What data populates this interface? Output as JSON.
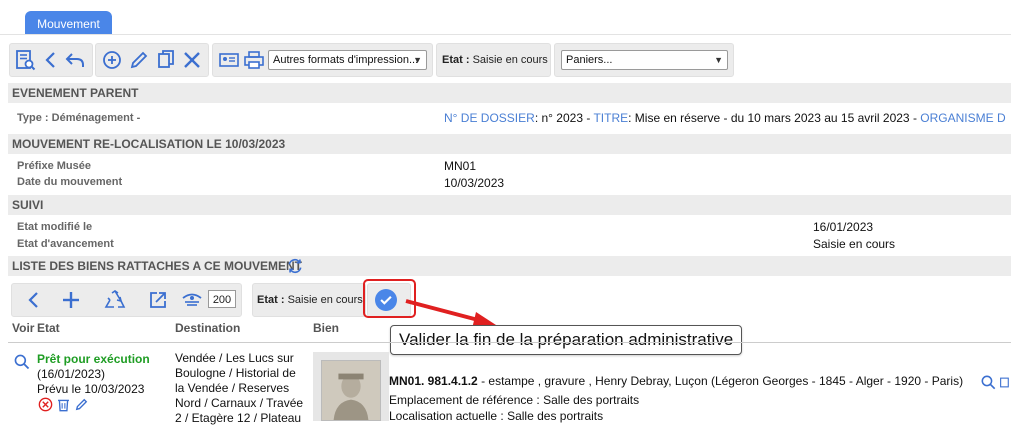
{
  "tab": {
    "label": "Mouvement"
  },
  "toolbar": {
    "print_formats": "Autres formats d'impression...",
    "etat_label": "Etat :",
    "etat_value": "Saisie en cours",
    "paniers": "Paniers..."
  },
  "parent": {
    "header": "EVENEMENT PARENT",
    "type_label": "Type : Déménagement -",
    "dossier_label": "N° DE DOSSIER",
    "dossier_value": ": n° 2023 -",
    "titre_label": "TITRE",
    "titre_value": ": Mise en réserve - du 10 mars 2023 au 15 avril 2023 -",
    "organisme_label": "ORGANISME D"
  },
  "movement": {
    "header": "MOUVEMENT RE-LOCALISATION LE 10/03/2023",
    "prefix_label": "Préfixe Musée",
    "prefix_value": "MN01",
    "date_label": "Date du mouvement",
    "date_value": "10/03/2023"
  },
  "suivi": {
    "header": "SUIVI",
    "modified_label": "Etat modifié le",
    "modified_value": "16/01/2023",
    "progress_label": "Etat d'avancement",
    "progress_value": "Saisie en cours"
  },
  "list": {
    "header": "LISTE DES BIENS RATTACHES A CE MOUVEMENT",
    "count": "200",
    "etat_label": "Etat :",
    "etat_value": "Saisie en cours",
    "tooltip": "Valider la fin de la préparation administrative",
    "columns": {
      "voir": "Voir",
      "etat": "Etat",
      "destination": "Destination",
      "bien": "Bien"
    },
    "rows": [
      {
        "status": "Prêt pour exécution",
        "status_date": "(16/01/2023)",
        "planned": "Prévu le 10/03/2023",
        "destination": [
          "Vendée / Les Lucs sur",
          "Boulogne / Historial de",
          "la Vendée / Reserves",
          "Nord / Carnaux / Travée",
          "2 / Etagère 12 / Plateau"
        ],
        "item_id": "MN01. 981.4.1.2",
        "item_desc": " - estampe , gravure , Henry Debray, Luçon (Légeron Georges - 1845 - Alger - 1920 - Paris)",
        "ref_location": "Emplacement de référence : Salle des portraits",
        "current_location": "Localisation actuelle : Salle des portraits"
      }
    ]
  },
  "colors": {
    "accent": "#4a86e8",
    "link": "#4a7fd4",
    "success": "#1f9d24",
    "danger": "#e02020"
  }
}
